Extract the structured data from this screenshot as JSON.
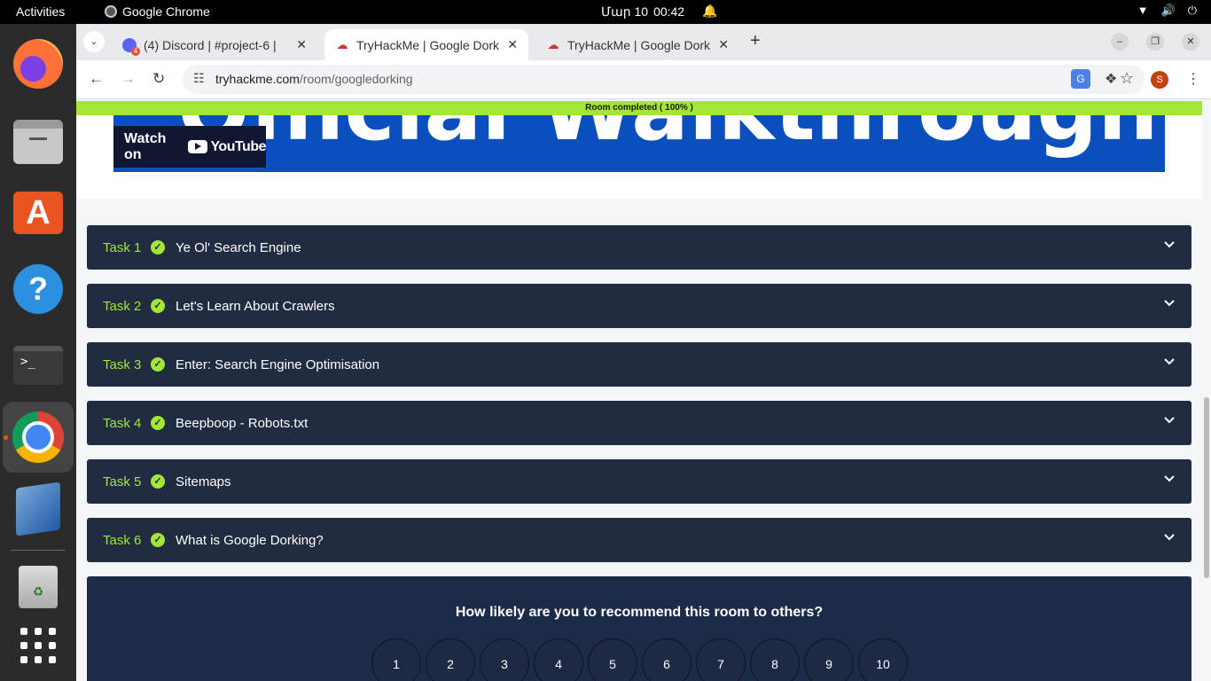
{
  "topbar": {
    "activities": "Activities",
    "app_name": "Google Chrome",
    "date": "Մար 10",
    "time": "00:42"
  },
  "dock": {
    "apps": [
      "firefox-icon",
      "files-icon",
      "app-center-icon",
      "help-icon",
      "terminal-icon",
      "chrome-icon",
      "virtualbox-icon",
      "trash-icon",
      "show-apps-icon"
    ],
    "terminal_glyph": ">_"
  },
  "tabs": [
    {
      "title": "(4) Discord | #project-6 |",
      "active": false
    },
    {
      "title": "TryHackMe | Google Dork",
      "active": true
    },
    {
      "title": "TryHackMe | Google Dork",
      "active": false
    }
  ],
  "toolbar": {
    "url_host": "tryhackme.com",
    "url_path": "/room/googledorking",
    "profile_initial": "S"
  },
  "page": {
    "progress_text": "Room completed ( 100% )",
    "progress_percent": 100,
    "video": {
      "banner_text": "Official Walkthrough",
      "watch_on": "Watch on",
      "youtube": "YouTube"
    },
    "tasks": [
      {
        "label": "Task 1",
        "title": "Ye Ol' Search Engine"
      },
      {
        "label": "Task 2",
        "title": "Let's Learn About Crawlers"
      },
      {
        "label": "Task 3",
        "title": "Enter: Search Engine Optimisation"
      },
      {
        "label": "Task 4",
        "title": "Beepboop - Robots.txt"
      },
      {
        "label": "Task 5",
        "title": "Sitemaps"
      },
      {
        "label": "Task 6",
        "title": "What is Google Dorking?"
      }
    ],
    "recommend": {
      "question": "How likely are you to recommend this room to others?",
      "options": [
        "1",
        "2",
        "3",
        "4",
        "5",
        "6",
        "7",
        "8",
        "9",
        "10"
      ]
    }
  },
  "colors": {
    "accent": "#a3e635",
    "task_bg": "#212c42",
    "rec_bg": "#1c2b48",
    "video_bg": "#0b4fbf"
  }
}
